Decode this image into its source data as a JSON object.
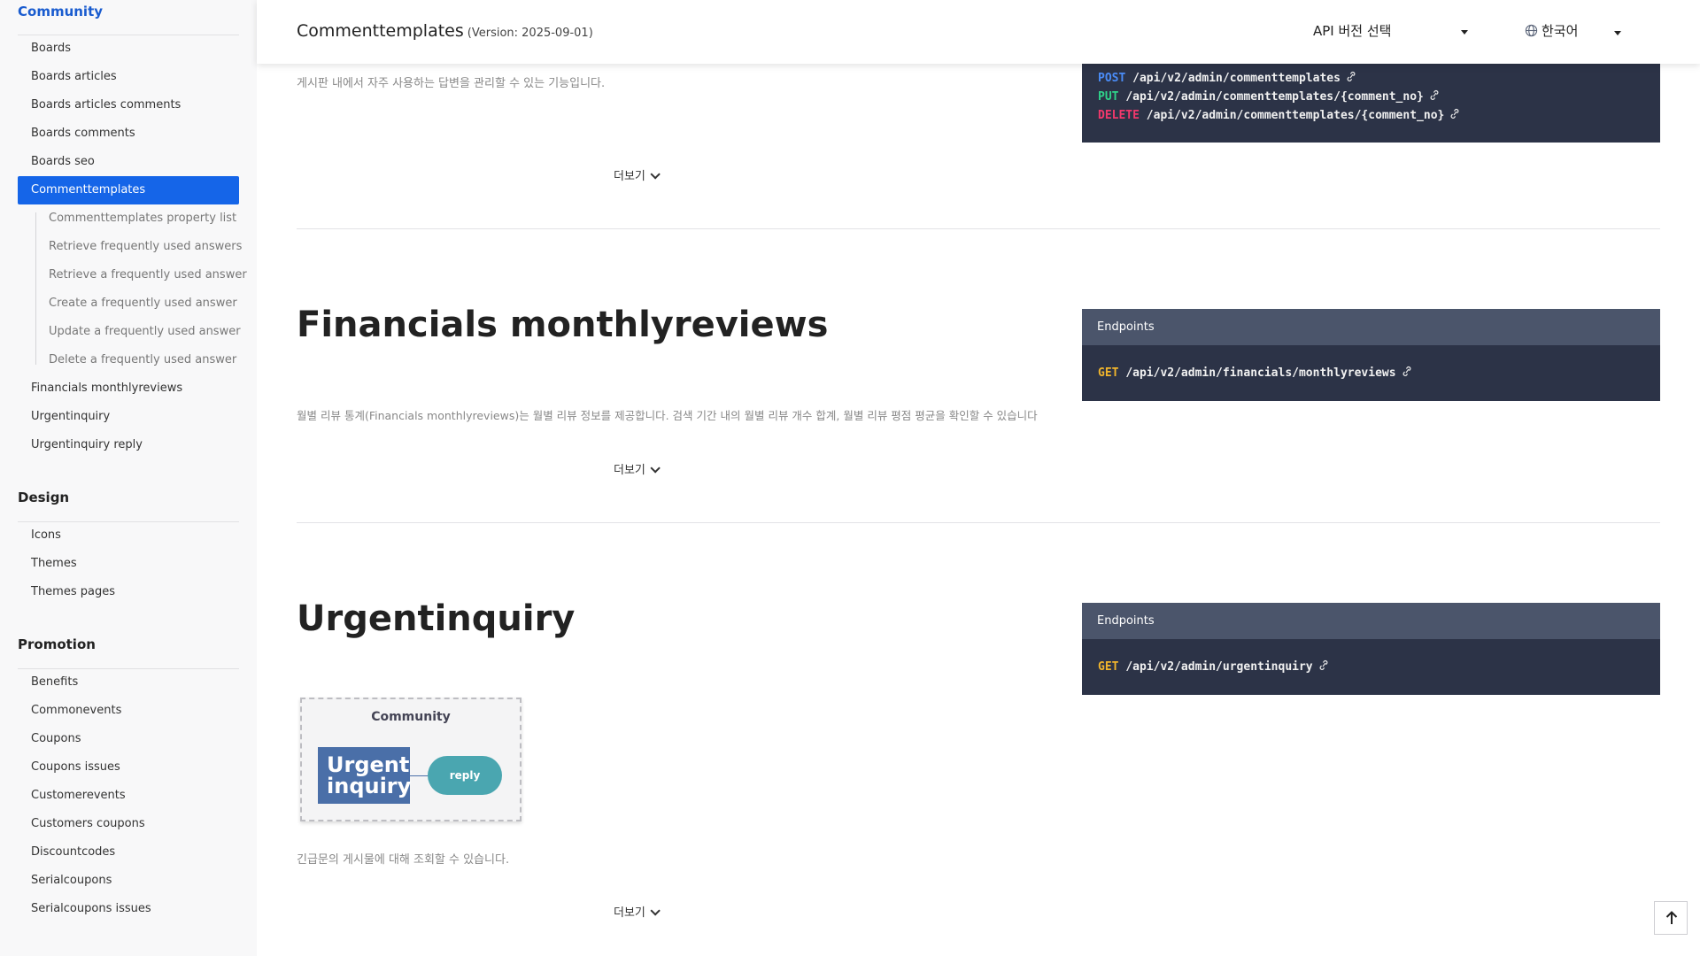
{
  "header": {
    "title": "Commenttemplates",
    "version": "(Version: 2025-09-01)",
    "api_select_label": "API 버전 선택",
    "language_label": "한국어"
  },
  "sidebar": {
    "community": {
      "title": "Community",
      "items": [
        "Boards",
        "Boards articles",
        "Boards articles comments",
        "Boards comments",
        "Boards seo"
      ],
      "active": "Commenttemplates",
      "subitems": [
        "Commenttemplates property list",
        "Retrieve frequently used answers",
        "Retrieve a frequently used answer",
        "Create a frequently used answer",
        "Update a frequently used answer",
        "Delete a frequently used answer"
      ],
      "items_after": [
        "Financials monthlyreviews",
        "Urgentinquiry",
        "Urgentinquiry reply"
      ]
    },
    "design": {
      "title": "Design",
      "items": [
        "Icons",
        "Themes",
        "Themes pages"
      ]
    },
    "promotion": {
      "title": "Promotion",
      "items": [
        "Benefits",
        "Commonevents",
        "Coupons",
        "Coupons issues",
        "Customerevents",
        "Customers coupons",
        "Discountcodes",
        "Serialcoupons",
        "Serialcoupons issues"
      ]
    }
  },
  "sections": {
    "commenttemplates": {
      "description": "게시판 내에서 자주 사용하는 답변을 관리할 수 있는 기능입니다.",
      "more_label": "더보기",
      "endpoints": [
        {
          "method": "POST",
          "path": "/api/v2/admin/commenttemplates"
        },
        {
          "method": "PUT",
          "path": "/api/v2/admin/commenttemplates/{comment_no}"
        },
        {
          "method": "DELETE",
          "path": "/api/v2/admin/commenttemplates/{comment_no}"
        }
      ]
    },
    "financials": {
      "title": "Financials monthlyreviews",
      "description": "월별 리뷰 통계(Financials monthlyreviews)는 월별 리뷰 정보를 제공합니다. 검색 기간 내의 월별 리뷰 개수 합계, 월별 리뷰 평점 평균을 확인할 수 있습니다",
      "more_label": "더보기",
      "endpoints_label": "Endpoints",
      "endpoints": [
        {
          "method": "GET",
          "path": "/api/v2/admin/financials/monthlyreviews"
        }
      ]
    },
    "urgentinquiry": {
      "title": "Urgentinquiry",
      "description": "긴급문의 게시물에 대해 조회할 수 있습니다.",
      "more_label": "더보기",
      "endpoints_label": "Endpoints",
      "endpoints": [
        {
          "method": "GET",
          "path": "/api/v2/admin/urgentinquiry"
        }
      ],
      "diagram": {
        "title": "Community",
        "box_line1": "Urgent",
        "box_line2": "inquiry",
        "pill": "reply"
      }
    }
  },
  "colors": {
    "accent": "#1565e8",
    "get": "#f1b52c",
    "post": "#4a8cf7",
    "put": "#2fd38a",
    "delete": "#f3386c",
    "endpoint_bg": "#2c3347"
  },
  "icons": {
    "link": "link-icon",
    "globe": "globe-icon",
    "scroll_top": "arrow-up-icon"
  }
}
